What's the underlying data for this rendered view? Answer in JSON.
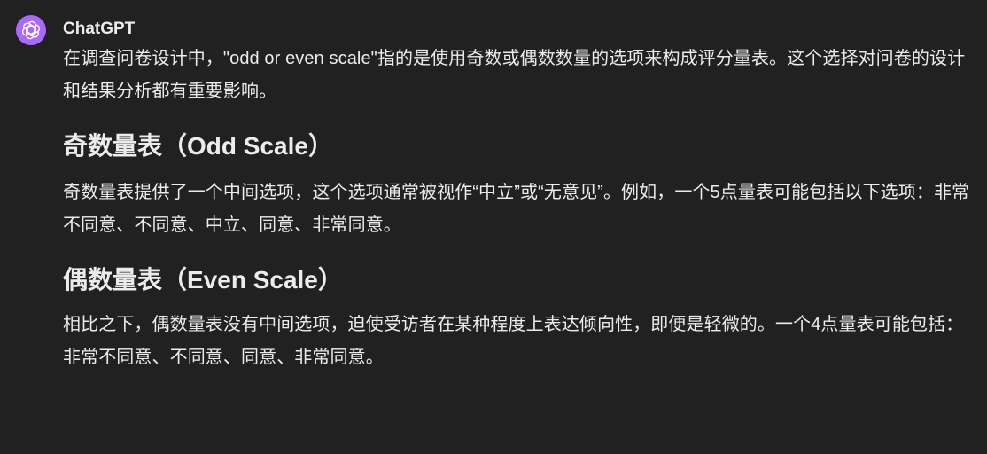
{
  "message": {
    "author": "ChatGPT",
    "avatar_icon": "openai-logo-icon",
    "avatar_color": "#ab68ff",
    "intro": "在调查问卷设计中，\"odd or even scale\"指的是使用奇数或偶数数量的选项来构成评分量表。这个选择对问卷的设计和结果分析都有重要影响。",
    "sections": [
      {
        "heading": "奇数量表（Odd Scale）",
        "body": "奇数量表提供了一个中间选项，这个选项通常被视作“中立”或“无意见”。例如，一个5点量表可能包括以下选项：非常不同意、不同意、中立、同意、非常同意。"
      },
      {
        "heading": "偶数量表（Even Scale）",
        "body": "相比之下，偶数量表没有中间选项，迫使受访者在某种程度上表达倾向性，即便是轻微的。一个4点量表可能包括：非常不同意、不同意、同意、非常同意。"
      }
    ]
  }
}
